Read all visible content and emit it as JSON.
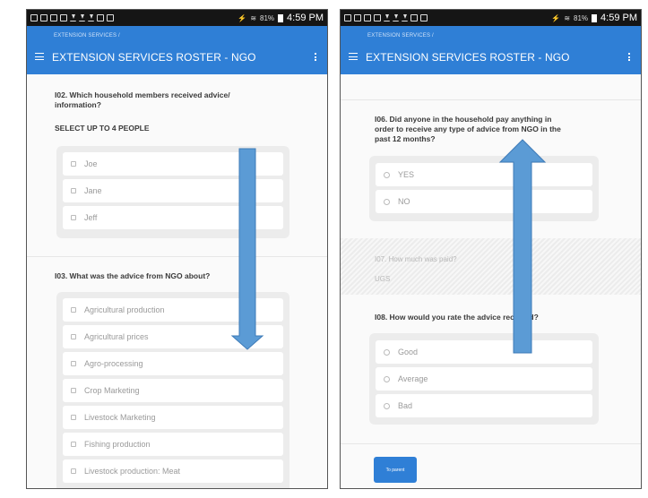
{
  "status_bar": {
    "battery": "81%",
    "time": "4:59 PM"
  },
  "left_phone": {
    "breadcrumb": "EXTENSION SERVICES /",
    "title": "EXTENSION SERVICES ROSTER - NGO",
    "q02": {
      "label_line1": "I02. Which household members received advice/",
      "label_line2": "information?",
      "hint": "SELECT UP TO 4 PEOPLE",
      "options": [
        "Joe",
        "Jane",
        "Jeff"
      ]
    },
    "q03": {
      "label": "I03. What was the advice from NGO about?",
      "options": [
        "Agricultural production",
        "Agricultural prices",
        "Agro-processing",
        "Crop Marketing",
        "Livestock Marketing",
        "Fishing production",
        "Livestock production: Meat"
      ]
    }
  },
  "right_phone": {
    "breadcrumb": "EXTENSION SERVICES /",
    "title": "EXTENSION SERVICES ROSTER - NGO",
    "q06": {
      "label_line1": "I06. Did anyone in the household pay anything in",
      "label_line2": "order to receive any type of advice from NGO in the",
      "label_line3": "past 12 months?",
      "options": [
        "YES",
        "NO"
      ]
    },
    "q07": {
      "label": "I07. How much was paid?",
      "unit": "UGS"
    },
    "q08": {
      "label": "I08. How would you rate the advice received?",
      "options": [
        "Good",
        "Average",
        "Bad"
      ]
    },
    "to_parent": "To parent"
  },
  "colors": {
    "appbar": "#2f7fd6",
    "arrow": "#5b9bd5"
  }
}
